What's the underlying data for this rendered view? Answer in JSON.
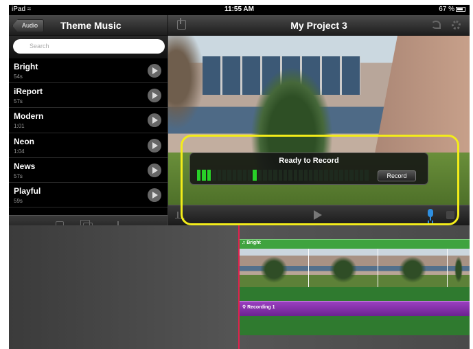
{
  "status_bar": {
    "carrier": "iPad",
    "time": "11:55 AM",
    "battery": "67 %"
  },
  "left_panel": {
    "back_label": "Audio",
    "title": "Theme Music",
    "search_placeholder": "Search",
    "songs": [
      {
        "name": "Bright",
        "duration": "54s"
      },
      {
        "name": "iReport",
        "duration": "57s"
      },
      {
        "name": "Modern",
        "duration": "1:01"
      },
      {
        "name": "Neon",
        "duration": "1:04"
      },
      {
        "name": "News",
        "duration": "57s"
      },
      {
        "name": "Playful",
        "duration": "59s"
      }
    ],
    "toolbar_icons": [
      "clips-icon",
      "photos-icon",
      "audio-icon"
    ]
  },
  "viewer": {
    "project_title": "My Project 3",
    "record_panel": {
      "title": "Ready to Record",
      "record_button": "Record",
      "meter_level": 0.27
    },
    "highlight_color": "#f3ec1a"
  },
  "timeline": {
    "music_track_label": "Bright",
    "recording_track_label": "Recording 1",
    "colors": {
      "music": "#3fa33f",
      "recording": "#8a34b5",
      "playhead": "#e0204e"
    }
  }
}
